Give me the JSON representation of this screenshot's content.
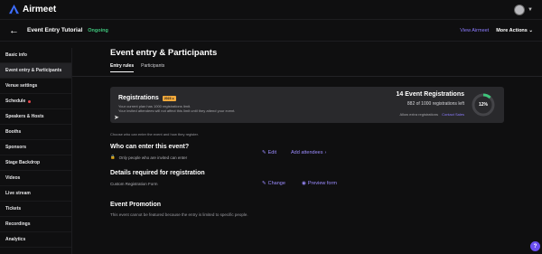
{
  "header": {
    "brand": "Airmeet"
  },
  "event": {
    "title": "Event Entry Tutorial",
    "status": "Ongoing",
    "view_link": "View Airmeet",
    "more_actions": "More Actions"
  },
  "sidebar": {
    "items": [
      {
        "label": "Basic info"
      },
      {
        "label": "Event entry & Participants"
      },
      {
        "label": "Venue settings"
      },
      {
        "label": "Schedule"
      },
      {
        "label": "Speakers & Hosts"
      },
      {
        "label": "Booths"
      },
      {
        "label": "Sponsors"
      },
      {
        "label": "Stage Backdrop"
      },
      {
        "label": "Videos"
      },
      {
        "label": "Live stream"
      },
      {
        "label": "Tickets"
      },
      {
        "label": "Recordings"
      },
      {
        "label": "Analytics"
      }
    ]
  },
  "main": {
    "title": "Event entry & Participants",
    "tabs": [
      "Entry rules",
      "Participants"
    ],
    "registrations": {
      "title": "Registrations",
      "badge": "2023 ●",
      "sub1": "Your current plan has 1000 registrations limit.",
      "sub2": "Your invited attendees will not affect this limit until they attend your event.",
      "count": "14 Event Registrations",
      "left": "882 of 1000 registrations left",
      "extra": "Allow extra registrations",
      "contact": "Contact Sales",
      "percent_label": "12%",
      "percent": 12
    },
    "hint": "Choose who can enter the event and how they register.",
    "who": {
      "title": "Who can enter this event?",
      "sub": "Only people who are invited can enter",
      "edit": "Edit",
      "add": "Add attendees"
    },
    "details": {
      "title": "Details required for registration",
      "sub": "Custom Registration Form",
      "change": "Change",
      "preview": "Preview form"
    },
    "promo": {
      "title": "Event Promotion",
      "text": "This event cannot be featured because the entry is limited to specific people."
    }
  },
  "colors": {
    "accent": "#8c7cff",
    "status": "#3ec47b",
    "donut": "#3ec47b"
  }
}
